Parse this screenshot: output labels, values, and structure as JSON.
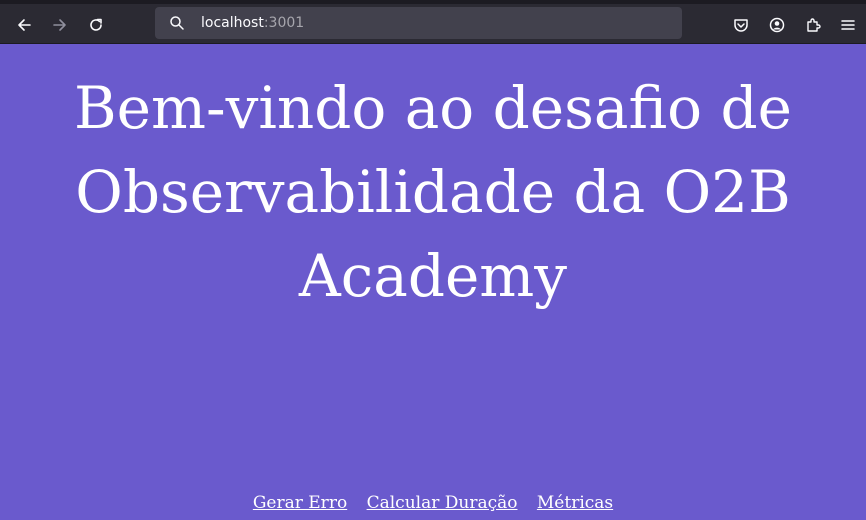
{
  "browser": {
    "url_host": "localhost",
    "url_port": ":3001",
    "icons": [
      "back-arrow-icon",
      "forward-arrow-icon",
      "reload-icon",
      "search-icon",
      "pocket-icon",
      "account-icon",
      "extensions-icon",
      "menu-icon"
    ]
  },
  "page": {
    "background_color": "#6a5acd",
    "title": "Bem-vindo ao desafio de Observabilidade da O2B Academy",
    "links": [
      {
        "label": "Gerar Erro"
      },
      {
        "label": "Calcular Duração"
      },
      {
        "label": "Métricas"
      }
    ]
  }
}
